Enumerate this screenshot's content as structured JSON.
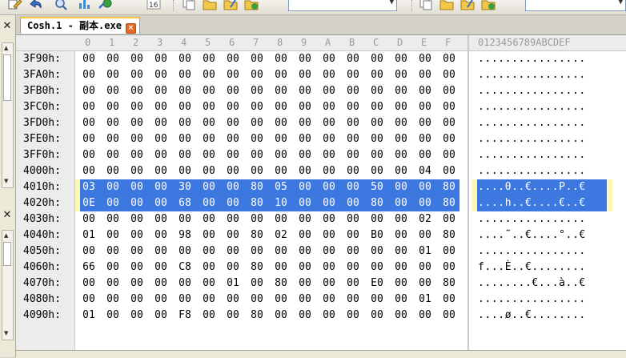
{
  "tab": {
    "title": "Cosh.1 - 副本.exe",
    "close_icon": "close-icon"
  },
  "colors": {
    "selection": "#3c78e0",
    "tab_accent": "#ffc83c"
  },
  "column_headers": [
    "0",
    "1",
    "2",
    "3",
    "4",
    "5",
    "6",
    "7",
    "8",
    "9",
    "A",
    "B",
    "C",
    "D",
    "E",
    "F"
  ],
  "ascii_header": "0123456789ABCDEF",
  "rows": [
    {
      "offset": "3F90h:",
      "bytes": [
        "00",
        "00",
        "00",
        "00",
        "00",
        "00",
        "00",
        "00",
        "00",
        "00",
        "00",
        "00",
        "00",
        "00",
        "00",
        "00"
      ],
      "ascii": "................",
      "selected": false
    },
    {
      "offset": "3FA0h:",
      "bytes": [
        "00",
        "00",
        "00",
        "00",
        "00",
        "00",
        "00",
        "00",
        "00",
        "00",
        "00",
        "00",
        "00",
        "00",
        "00",
        "00"
      ],
      "ascii": "................",
      "selected": false
    },
    {
      "offset": "3FB0h:",
      "bytes": [
        "00",
        "00",
        "00",
        "00",
        "00",
        "00",
        "00",
        "00",
        "00",
        "00",
        "00",
        "00",
        "00",
        "00",
        "00",
        "00"
      ],
      "ascii": "................",
      "selected": false
    },
    {
      "offset": "3FC0h:",
      "bytes": [
        "00",
        "00",
        "00",
        "00",
        "00",
        "00",
        "00",
        "00",
        "00",
        "00",
        "00",
        "00",
        "00",
        "00",
        "00",
        "00"
      ],
      "ascii": "................",
      "selected": false
    },
    {
      "offset": "3FD0h:",
      "bytes": [
        "00",
        "00",
        "00",
        "00",
        "00",
        "00",
        "00",
        "00",
        "00",
        "00",
        "00",
        "00",
        "00",
        "00",
        "00",
        "00"
      ],
      "ascii": "................",
      "selected": false
    },
    {
      "offset": "3FE0h:",
      "bytes": [
        "00",
        "00",
        "00",
        "00",
        "00",
        "00",
        "00",
        "00",
        "00",
        "00",
        "00",
        "00",
        "00",
        "00",
        "00",
        "00"
      ],
      "ascii": "................",
      "selected": false
    },
    {
      "offset": "3FF0h:",
      "bytes": [
        "00",
        "00",
        "00",
        "00",
        "00",
        "00",
        "00",
        "00",
        "00",
        "00",
        "00",
        "00",
        "00",
        "00",
        "00",
        "00"
      ],
      "ascii": "................",
      "selected": false
    },
    {
      "offset": "4000h:",
      "bytes": [
        "00",
        "00",
        "00",
        "00",
        "00",
        "00",
        "00",
        "00",
        "00",
        "00",
        "00",
        "00",
        "00",
        "00",
        "04",
        "00"
      ],
      "ascii": "................",
      "selected": false
    },
    {
      "offset": "4010h:",
      "bytes": [
        "03",
        "00",
        "00",
        "00",
        "30",
        "00",
        "00",
        "80",
        "05",
        "00",
        "00",
        "00",
        "50",
        "00",
        "00",
        "80"
      ],
      "ascii": "....0..€....P..€",
      "selected": true
    },
    {
      "offset": "4020h:",
      "bytes": [
        "0E",
        "00",
        "00",
        "00",
        "68",
        "00",
        "00",
        "80",
        "10",
        "00",
        "00",
        "00",
        "80",
        "00",
        "00",
        "80"
      ],
      "ascii": "....h..€....€..€",
      "selected": true
    },
    {
      "offset": "4030h:",
      "bytes": [
        "00",
        "00",
        "00",
        "00",
        "00",
        "00",
        "00",
        "00",
        "00",
        "00",
        "00",
        "00",
        "00",
        "00",
        "02",
        "00"
      ],
      "ascii": "................",
      "selected": false
    },
    {
      "offset": "4040h:",
      "bytes": [
        "01",
        "00",
        "00",
        "00",
        "98",
        "00",
        "00",
        "80",
        "02",
        "00",
        "00",
        "00",
        "B0",
        "00",
        "00",
        "80"
      ],
      "ascii": "....˜..€....°..€",
      "selected": false
    },
    {
      "offset": "4050h:",
      "bytes": [
        "00",
        "00",
        "00",
        "00",
        "00",
        "00",
        "00",
        "00",
        "00",
        "00",
        "00",
        "00",
        "00",
        "00",
        "01",
        "00"
      ],
      "ascii": "................",
      "selected": false
    },
    {
      "offset": "4060h:",
      "bytes": [
        "66",
        "00",
        "00",
        "00",
        "C8",
        "00",
        "00",
        "80",
        "00",
        "00",
        "00",
        "00",
        "00",
        "00",
        "00",
        "00"
      ],
      "ascii": "f...È..€........",
      "selected": false
    },
    {
      "offset": "4070h:",
      "bytes": [
        "00",
        "00",
        "00",
        "00",
        "00",
        "00",
        "01",
        "00",
        "80",
        "00",
        "00",
        "00",
        "E0",
        "00",
        "00",
        "80"
      ],
      "ascii": "........€...à..€",
      "selected": false
    },
    {
      "offset": "4080h:",
      "bytes": [
        "00",
        "00",
        "00",
        "00",
        "00",
        "00",
        "00",
        "00",
        "00",
        "00",
        "00",
        "00",
        "00",
        "00",
        "01",
        "00"
      ],
      "ascii": "................",
      "selected": false
    },
    {
      "offset": "4090h:",
      "bytes": [
        "01",
        "00",
        "00",
        "00",
        "F8",
        "00",
        "00",
        "80",
        "00",
        "00",
        "00",
        "00",
        "00",
        "00",
        "00",
        "00"
      ],
      "ascii": "....ø..€........",
      "selected": false
    }
  ]
}
